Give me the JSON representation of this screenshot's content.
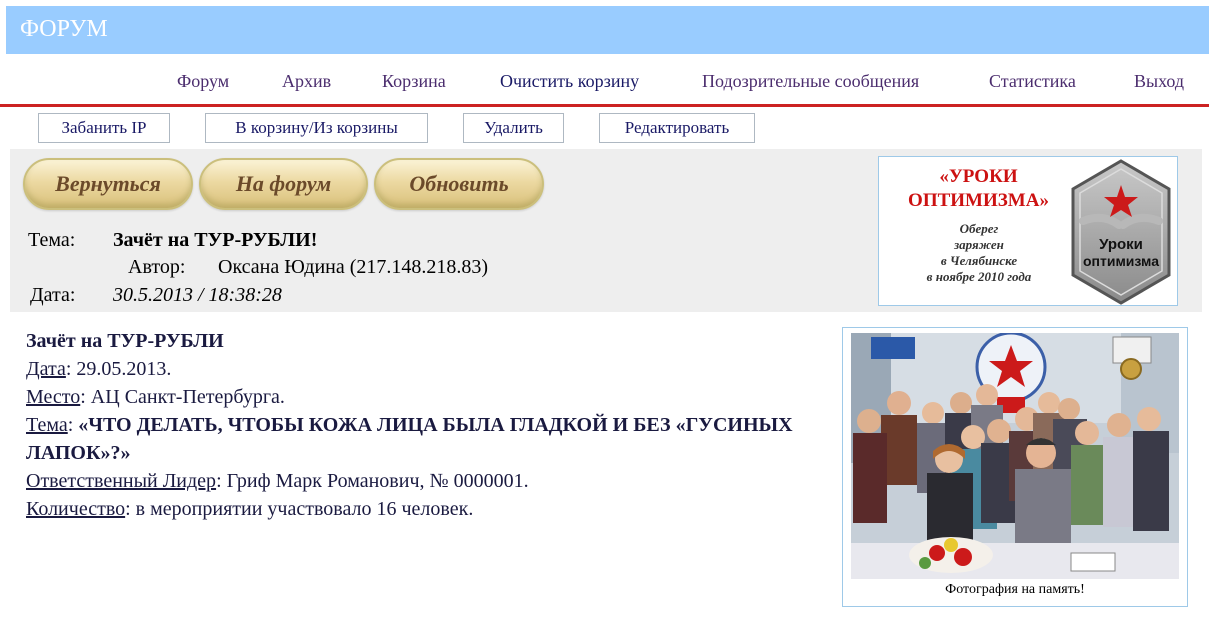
{
  "header": {
    "title": "ФОРУМ"
  },
  "nav": {
    "items": [
      "Форум",
      "Архив",
      "Корзина",
      "Очистить корзину",
      "Подозрительные сообщения",
      "Статистика",
      "Выход"
    ]
  },
  "toolbar": {
    "ban_ip": "Забанить IP",
    "trash_toggle": "В корзину/Из корзины",
    "delete": "Удалить",
    "edit": "Редактировать"
  },
  "actions": {
    "back": "Вернуться",
    "to_forum": "На форум",
    "refresh": "Обновить"
  },
  "message_meta": {
    "topic_label": "Тема:",
    "topic_value": "Зачёт на ТУР-РУБЛИ!",
    "author_label": "Автор:",
    "author_value": "Оксана Юдина (217.148.218.83)",
    "date_label": "Дата:",
    "date_value": "30.5.2013 / 18:38:28"
  },
  "banner": {
    "title_line1": "«УРОКИ",
    "title_line2": "ОПТИМИЗМА»",
    "text_line1": "Оберег",
    "text_line2": "заряжен",
    "text_line3": "в Челябинске",
    "text_line4": "в ноябре 2010 года",
    "logo_line1": "Уроки",
    "logo_line2": "оптимизма"
  },
  "post": {
    "title": "Зачёт на ТУР-РУБЛИ",
    "date_label": "Дата",
    "date_value": ": 29.05.2013.",
    "place_label": "Место",
    "place_value": ": АЦ Санкт-Петербурга.",
    "topic_label": "Тема",
    "topic_sep": ": ",
    "topic_value": "«ЧТО ДЕЛАТЬ, ЧТОБЫ КОЖА ЛИЦА БЫЛА ГЛАДКОЙ И БЕЗ «ГУСИНЫХ ЛАПОК»?»",
    "leader_label": "Ответственный Лидер",
    "leader_value": ": Гриф Марк Романович, № 0000001.",
    "count_label": "Количество",
    "count_value": ": в мероприятии участвовало 16 человек."
  },
  "photo": {
    "caption": "Фотография на память!"
  },
  "colors": {
    "header_bg": "#99ccff",
    "nav_line": "#cc2222",
    "accent_red": "#cc1111"
  }
}
